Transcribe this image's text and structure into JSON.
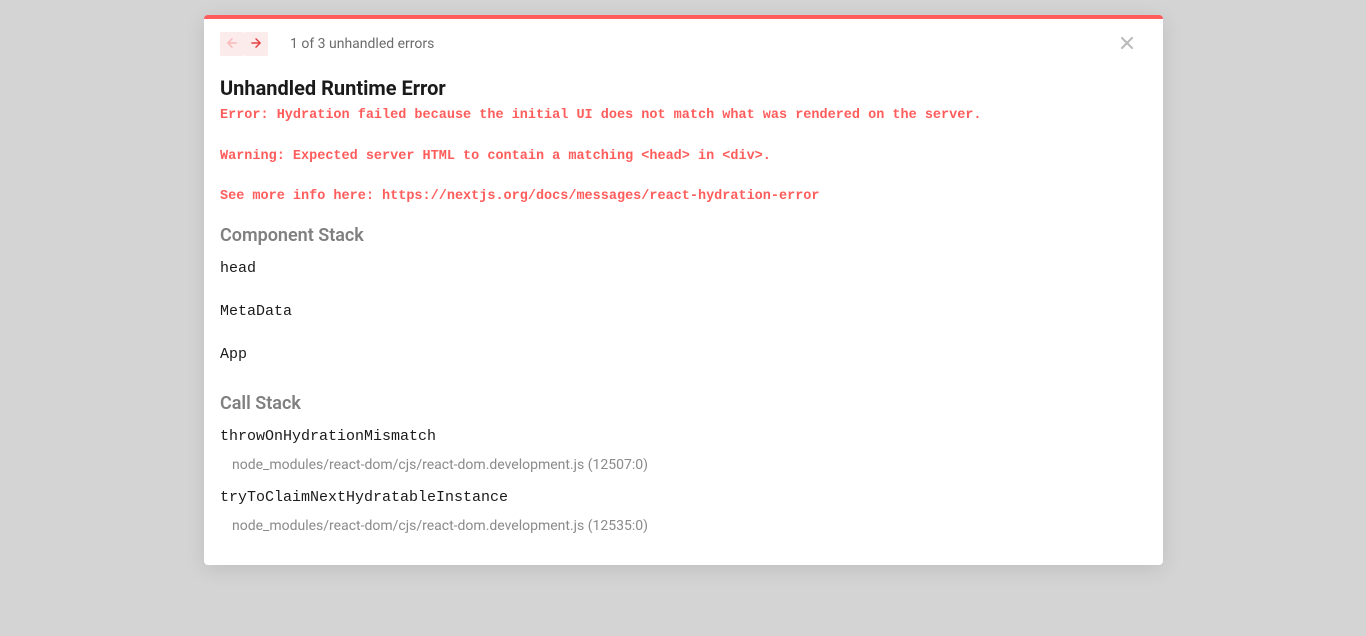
{
  "header": {
    "count_text": "1 of 3 unhandled errors"
  },
  "error": {
    "title": "Unhandled Runtime Error",
    "message": "Error: Hydration failed because the initial UI does not match what was rendered on the server.\n\nWarning: Expected server HTML to contain a matching <head> in <div>.\n\nSee more info here: https://nextjs.org/docs/messages/react-hydration-error"
  },
  "component_stack": {
    "heading": "Component Stack",
    "items": [
      "head",
      "MetaData",
      "App"
    ]
  },
  "call_stack": {
    "heading": "Call Stack",
    "items": [
      {
        "fn": "throwOnHydrationMismatch",
        "src": "node_modules/react-dom/cjs/react-dom.development.js (12507:0)"
      },
      {
        "fn": "tryToClaimNextHydratableInstance",
        "src": "node_modules/react-dom/cjs/react-dom.development.js (12535:0)"
      }
    ]
  },
  "colors": {
    "accent": "#ff5c5c",
    "nav_bg": "#fcebeb"
  }
}
